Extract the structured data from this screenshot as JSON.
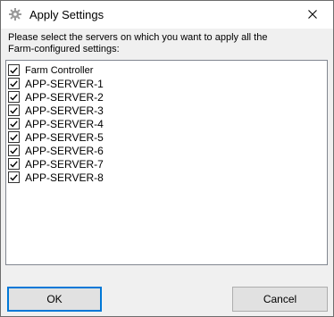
{
  "window": {
    "title": "Apply Settings",
    "icon": "gear-icon"
  },
  "instructions": "Please select the servers on which you want to apply all the Farm-configured settings:",
  "servers": [
    {
      "label": "Farm Controller",
      "checked": true
    },
    {
      "label": "APP-SERVER-1",
      "checked": true
    },
    {
      "label": "APP-SERVER-2",
      "checked": true
    },
    {
      "label": "APP-SERVER-3",
      "checked": true
    },
    {
      "label": "APP-SERVER-4",
      "checked": true
    },
    {
      "label": "APP-SERVER-5",
      "checked": true
    },
    {
      "label": "APP-SERVER-6",
      "checked": true
    },
    {
      "label": "APP-SERVER-7",
      "checked": true
    },
    {
      "label": "APP-SERVER-8",
      "checked": true
    }
  ],
  "buttons": {
    "ok_label": "OK",
    "cancel_label": "Cancel"
  },
  "colors": {
    "accent": "#0078d7",
    "list_border": "#828790",
    "dialog_bg": "#f0f0f0"
  }
}
